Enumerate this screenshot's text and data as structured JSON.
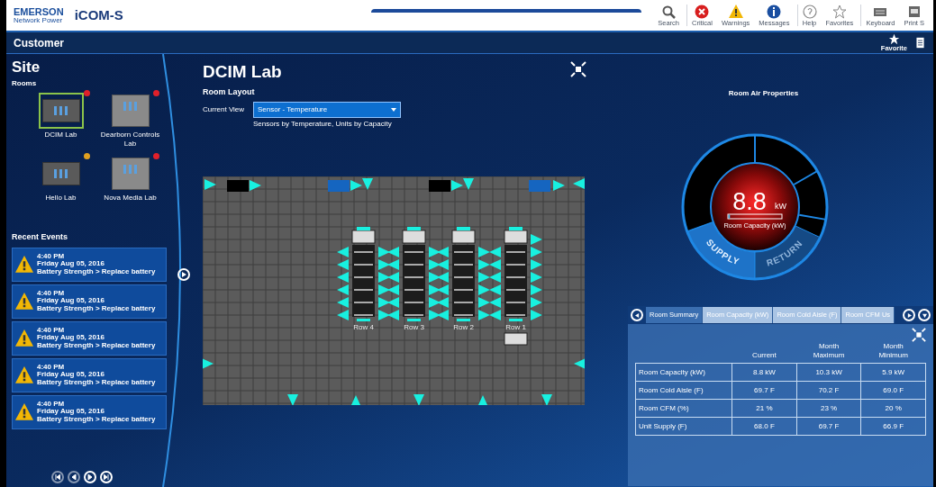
{
  "header": {
    "brand": "EMERSON",
    "brand_sub": "Network Power",
    "app": "iCOM-S",
    "toolbar": [
      {
        "kind": "search",
        "label": "Search"
      },
      {
        "kind": "critical",
        "label": "Critical"
      },
      {
        "kind": "warnings",
        "label": "Warnings"
      },
      {
        "kind": "messages",
        "label": "Messages"
      },
      {
        "kind": "help",
        "label": "Help"
      },
      {
        "kind": "favorites",
        "label": "Favorites"
      },
      {
        "kind": "keyboard",
        "label": "Keyboard"
      },
      {
        "kind": "print",
        "label": "Print S"
      }
    ]
  },
  "nav": {
    "title": "Customer",
    "actions": [
      {
        "kind": "star",
        "label": "Favorite"
      },
      {
        "kind": "document"
      }
    ]
  },
  "site": {
    "title": "Site",
    "rooms_label": "Rooms",
    "rooms": [
      {
        "name": "DCIM Lab",
        "selected": true,
        "color": "#e0202a"
      },
      {
        "name": "Dearborn Controls Lab",
        "selected": false,
        "color": "#e0202a"
      },
      {
        "name": "Hello Lab",
        "selected": false,
        "color": "#e0a020"
      },
      {
        "name": "Nova Media Lab",
        "selected": false,
        "color": "#e0202a"
      }
    ],
    "events_label": "Recent Events",
    "events": [
      {
        "time": "4:40 PM",
        "date": "Friday Aug 05, 2016",
        "message": "Battery Strength > Replace battery"
      },
      {
        "time": "4:40 PM",
        "date": "Friday Aug 05, 2016",
        "message": "Battery Strength > Replace battery"
      },
      {
        "time": "4:40 PM",
        "date": "Friday Aug 05, 2016",
        "message": "Battery Strength > Replace battery"
      },
      {
        "time": "4:40 PM",
        "date": "Friday Aug 05, 2016",
        "message": "Battery Strength > Replace battery"
      },
      {
        "time": "4:40 PM",
        "date": "Friday Aug 05, 2016",
        "message": "Battery Strength > Replace battery"
      }
    ],
    "pager": [
      {
        "kind": "first"
      },
      {
        "kind": "prev"
      },
      {
        "kind": "next"
      },
      {
        "kind": "last"
      }
    ]
  },
  "layout": {
    "title": "DCIM Lab",
    "subtitle": "Room Layout",
    "view_label": "Current View",
    "view_value": "Sensor - Temperature",
    "view_hint": "Sensors by Temperature, Units by Capacity",
    "rows": [
      "Row 4",
      "Row 3",
      "Row 2",
      "Row 1"
    ]
  },
  "air": {
    "title": "Room Air Properties",
    "value": "8.8",
    "unit": "kW",
    "bar_label": "Room Capacity (kW)",
    "level": 0.03,
    "modes": [
      {
        "label": "SUPPLY",
        "selected": true
      },
      {
        "label": "RETURN",
        "selected": false
      }
    ]
  },
  "summary": {
    "tabs": [
      {
        "label": "Room Summary",
        "selected": true
      },
      {
        "label": "Room Capacity (kW)",
        "selected": false
      },
      {
        "label": "Room Cold Aisle (F)",
        "selected": false
      },
      {
        "label": "Room CFM Us",
        "selected": false
      }
    ],
    "columns": [
      "Current",
      "Month Maximum",
      "Month Minimum"
    ],
    "rows": [
      {
        "label": "Room Capacity (kW)",
        "values": [
          "8.8 kW",
          "10.3 kW",
          "5.9 kW"
        ]
      },
      {
        "label": "Room Cold Aisle (F)",
        "values": [
          "69.7 F",
          "70.2 F",
          "69.0 F"
        ]
      },
      {
        "label": "Room CFM (%)",
        "values": [
          "21 %",
          "23 %",
          "20 %"
        ]
      },
      {
        "label": "Unit Supply (F)",
        "values": [
          "68.0 F",
          "69.7 F",
          "66.9 F"
        ]
      }
    ]
  }
}
